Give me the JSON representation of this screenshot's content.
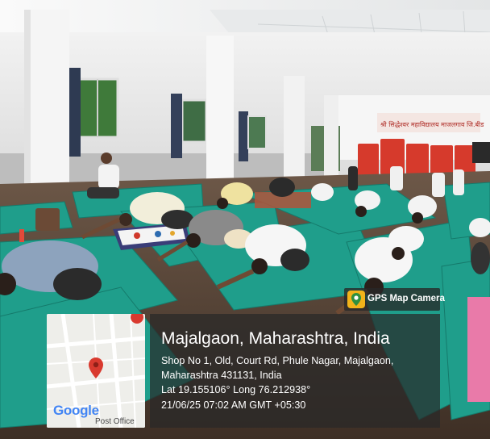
{
  "wall_banner_text": "श्री सिद्धेश्वर महाविद्यालय माजलगाव जि.बीड",
  "gps_badge": {
    "label": "GPS Map Camera",
    "icon": "gps-map-camera-icon"
  },
  "location": {
    "title": "Majalgaon, Maharashtra, India",
    "address_line1": "Shop No 1, Old, Court Rd, Phule Nagar, Majalgaon,",
    "address_line2": "Maharashtra 431131, India",
    "coordinates": "Lat 19.155106° Long 76.212938°",
    "datetime": "21/06/25 07:02 AM GMT +05:30"
  },
  "map": {
    "provider_label": "Google",
    "place_label": "Post Office",
    "pin_icon": "map-pin-icon",
    "colors": {
      "pin": "#d93a2f",
      "road": "#ffffff",
      "land": "#eeeeea"
    }
  },
  "colors": {
    "mat": "#1f9e8b",
    "wall": "#ececec",
    "panel": "#2b2b2b",
    "floor": "#5c4636"
  }
}
